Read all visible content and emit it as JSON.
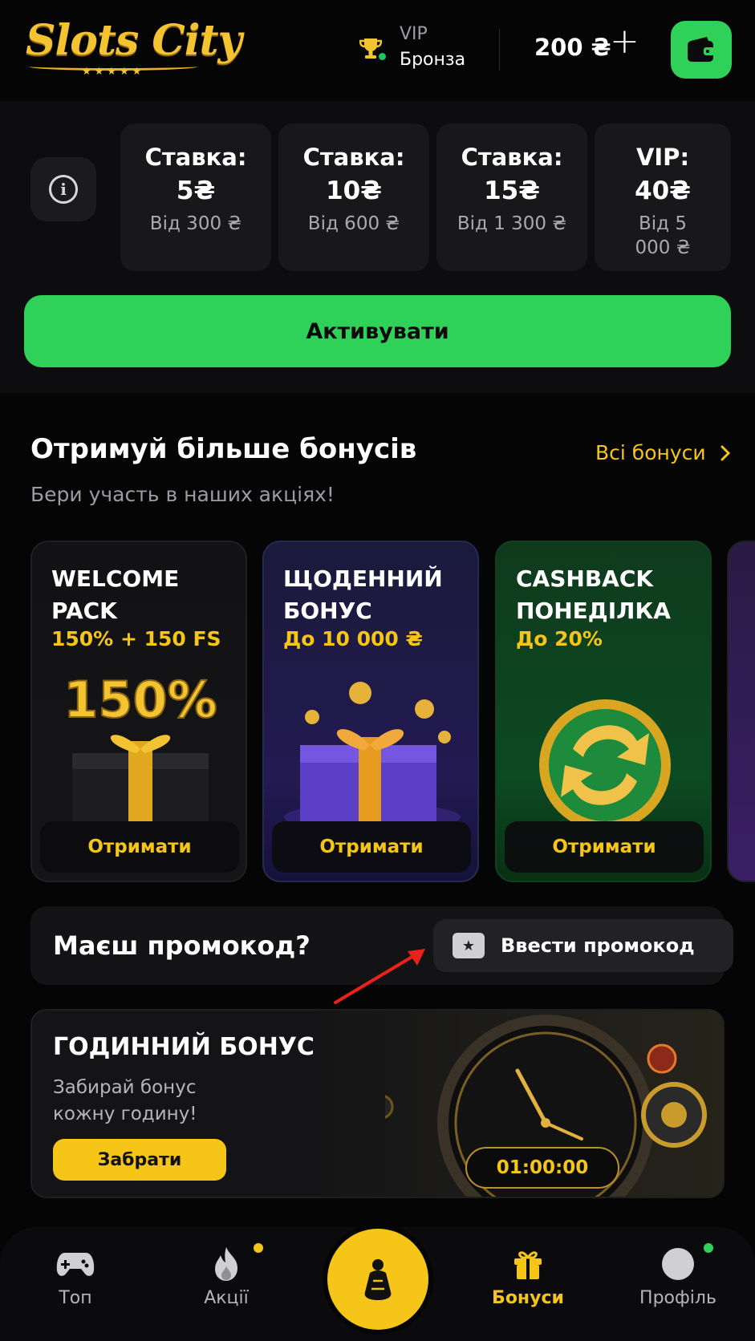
{
  "header": {
    "logo_text": "Slots City",
    "logo_stars": "★★★★★",
    "vip_label": "VIP",
    "vip_level": "Бронза",
    "balance": "200 ₴",
    "plus_symbol": "+",
    "trophy_icon": "trophy-icon",
    "wallet_icon": "wallet-icon"
  },
  "bets": {
    "info_icon": "info-icon",
    "info_symbol": "i",
    "items": [
      {
        "title": "Ставка:",
        "amount": "5₴",
        "from": "Від 300 ₴"
      },
      {
        "title": "Ставка:",
        "amount": "10₴",
        "from": "Від 600 ₴"
      },
      {
        "title": "Ставка:",
        "amount": "15₴",
        "from": "Від 1 300 ₴"
      },
      {
        "title": "VIP:",
        "amount": "40₴",
        "from": "Від 5 000 ₴"
      }
    ],
    "activate_label": "Активувати"
  },
  "bonuses": {
    "title": "Отримуй більше бонусів",
    "subtitle": "Бери участь в наших акціях!",
    "all_link": "Всі бонуси",
    "cards": [
      {
        "name": "WELCOME PACK",
        "offer": "150% + 150 FS",
        "button": "Отримати",
        "art_text": "150%"
      },
      {
        "name": "ЩОДЕННИЙ БОНУС",
        "offer": "До 10 000 ₴",
        "button": "Отримати"
      },
      {
        "name": "CASHBACK ПОНЕДІЛКА",
        "offer": "До 20%",
        "button": "Отримати"
      }
    ]
  },
  "promocode": {
    "question": "Маєш промокод?",
    "button": "Ввести промокод",
    "ticket_symbol": "★"
  },
  "hourly": {
    "title": "ГОДИННИЙ БОНУС",
    "subtitle": "Забирай бонус кожну годину!",
    "button": "Забрати",
    "timer": "01:00:00"
  },
  "nav": {
    "items": [
      {
        "label": "Топ",
        "icon": "gamepad-icon"
      },
      {
        "label": "Акції",
        "icon": "fire-icon"
      },
      {
        "label": "Бонуси",
        "icon": "gift-icon"
      },
      {
        "label": "Профіль",
        "icon": "profile-icon"
      }
    ],
    "center_icon": "casino-icon",
    "active": "Бонуси",
    "colors": {
      "accent": "#f5c518",
      "green": "#30d158"
    }
  }
}
